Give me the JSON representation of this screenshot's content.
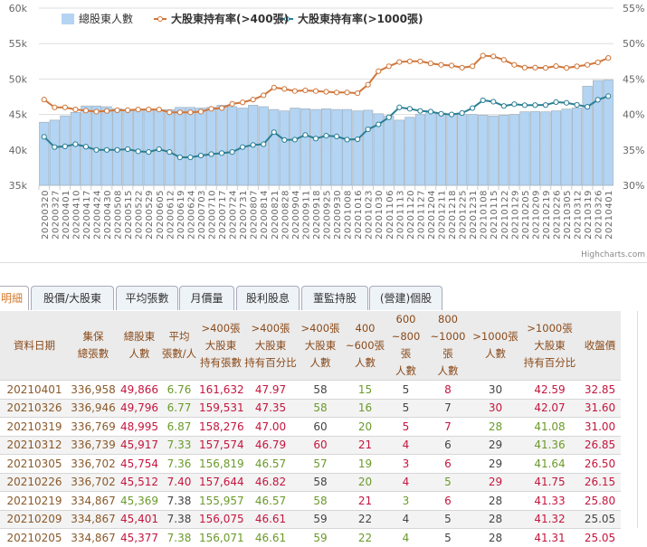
{
  "chart_data": {
    "type": "bar+line",
    "legend": [
      "總股東人數",
      "大股東持有率(>400張)",
      "大股東持有率(>1000張)"
    ],
    "legend_position": "top-left",
    "y_left": {
      "ticks": [
        "35k",
        "40k",
        "45k",
        "50k",
        "55k",
        "60k"
      ],
      "range": [
        35,
        60
      ]
    },
    "y_right": {
      "ticks": [
        "30%",
        "35%",
        "40%",
        "45%",
        "50%",
        "55%"
      ],
      "range": [
        30,
        55
      ]
    },
    "categories": [
      "20200320",
      "20200327",
      "20200401",
      "20200410",
      "20200417",
      "20200424",
      "20200430",
      "20200508",
      "20200515",
      "20200522",
      "20200529",
      "20200605",
      "20200612",
      "20200619",
      "20200624",
      "20200703",
      "20200710",
      "20200717",
      "20200724",
      "20200731",
      "20200807",
      "20200814",
      "20200821",
      "20200828",
      "20200904",
      "20200911",
      "20200918",
      "20200925",
      "20200930",
      "20201008",
      "20201016",
      "20201023",
      "20201030",
      "20201106",
      "20201113",
      "20201120",
      "20201127",
      "20201204",
      "20201211",
      "20201218",
      "20201225",
      "20201231",
      "20210108",
      "20210115",
      "20210122",
      "20210129",
      "20210205",
      "20210209",
      "20210219",
      "20210226",
      "20210305",
      "20210312",
      "20210319",
      "20210326",
      "20210401"
    ],
    "series": [
      {
        "name": "總股東人數",
        "type": "bar",
        "color": "#b3d4f2",
        "values": [
          43.9,
          44.2,
          44.8,
          45.3,
          46.2,
          46.2,
          46.1,
          45.8,
          45.7,
          45.7,
          45.7,
          45.7,
          45.7,
          46.0,
          46.0,
          45.9,
          46.0,
          46.3,
          46.1,
          45.9,
          46.3,
          46.1,
          45.7,
          45.5,
          45.9,
          45.8,
          45.7,
          45.8,
          45.7,
          45.7,
          45.5,
          45.6,
          45.1,
          44.8,
          44.2,
          44.6,
          45.0,
          45.3,
          45.2,
          45.0,
          45.0,
          45.0,
          44.9,
          44.8,
          44.9,
          45.0,
          45.377,
          45.401,
          45.369,
          45.512,
          45.754,
          45.917,
          48.995,
          49.796,
          49.866
        ]
      },
      {
        "name": "大股東持有率(>400張)",
        "type": "line",
        "color": "#d0763a",
        "values": [
          42.1,
          41.0,
          41.0,
          40.7,
          40.55,
          40.4,
          40.5,
          40.6,
          40.6,
          40.7,
          40.7,
          40.7,
          40.3,
          40.3,
          40.3,
          40.4,
          40.8,
          40.9,
          41.5,
          41.7,
          42.1,
          42.7,
          43.8,
          43.6,
          43.3,
          43.4,
          43.3,
          43.2,
          43.1,
          43.1,
          43.0,
          44.2,
          46.1,
          46.8,
          47.4,
          47.5,
          47.5,
          47.2,
          47.0,
          46.9,
          46.6,
          46.8,
          48.3,
          48.2,
          47.7,
          47.0,
          46.61,
          46.61,
          46.57,
          46.82,
          46.57,
          46.79,
          47.0,
          47.35,
          47.97
        ]
      },
      {
        "name": "大股東持有率(>1000張)",
        "type": "line",
        "color": "#2a7f95",
        "values": [
          36.85,
          35.4,
          35.5,
          35.8,
          35.45,
          35.0,
          35.0,
          35.0,
          35.1,
          34.8,
          34.7,
          35.1,
          34.7,
          33.95,
          33.95,
          34.2,
          34.4,
          34.55,
          34.7,
          35.4,
          35.7,
          35.8,
          37.5,
          36.4,
          36.45,
          37.1,
          36.6,
          37.0,
          36.9,
          36.45,
          36.5,
          37.9,
          38.6,
          39.6,
          41.0,
          40.8,
          40.5,
          40.4,
          40.1,
          40.0,
          40.2,
          40.9,
          42.0,
          41.8,
          41.2,
          41.45,
          41.31,
          41.32,
          41.33,
          41.75,
          41.64,
          41.36,
          41.08,
          42.07,
          42.59
        ]
      }
    ],
    "credits": "Highcharts.com"
  },
  "tabs": [
    "明細",
    "股價/大股東",
    "平均張數",
    "月價量",
    "股利股息",
    "董監持股",
    "(營建)個股"
  ],
  "table": {
    "headers": [
      [
        "資料日期"
      ],
      [
        "集保",
        "總張數"
      ],
      [
        "總股東",
        "人數"
      ],
      [
        "平均",
        "張數/人"
      ],
      [
        ">400張",
        "大股東",
        "持有張數"
      ],
      [
        ">400張",
        "大股東",
        "持有百分比"
      ],
      [
        ">400張",
        "大股東",
        "人數"
      ],
      [
        "400",
        "~600張",
        "人數"
      ],
      [
        "600",
        "~800張",
        "人數"
      ],
      [
        "800",
        "~1000張",
        "人數"
      ],
      [
        ">1000張",
        "人數"
      ],
      [
        ">1000張",
        "大股東",
        "持有百分比"
      ],
      [
        "收盤價"
      ]
    ],
    "rows": [
      {
        "cells": [
          "20210401",
          "336,958",
          "49,866",
          "6.76",
          "161,632",
          "47.97",
          "58",
          "15",
          "5",
          "8",
          "30",
          "42.59",
          "32.85"
        ],
        "colors": "bbrgrrngnrnrr"
      },
      {
        "cells": [
          "20210326",
          "336,946",
          "49,796",
          "6.77",
          "159,531",
          "47.35",
          "58",
          "16",
          "5",
          "7",
          "30",
          "42.07",
          "31.60"
        ],
        "colors": "bbrgrrggnnrrr"
      },
      {
        "cells": [
          "20210319",
          "336,769",
          "48,995",
          "6.87",
          "158,276",
          "47.00",
          "60",
          "20",
          "5",
          "7",
          "28",
          "41.08",
          "31.00"
        ],
        "colors": "bbrgrrngrrggr"
      },
      {
        "cells": [
          "20210312",
          "336,739",
          "45,917",
          "7.33",
          "157,574",
          "46.79",
          "60",
          "21",
          "4",
          "6",
          "29",
          "41.36",
          "26.85"
        ],
        "colors": "bbrgrrrrrnngr"
      },
      {
        "cells": [
          "20210305",
          "336,702",
          "45,754",
          "7.36",
          "156,819",
          "46.57",
          "57",
          "19",
          "3",
          "6",
          "29",
          "41.64",
          "26.50"
        ],
        "colors": "bbrgggggrrngr"
      },
      {
        "cells": [
          "20210226",
          "336,702",
          "45,512",
          "7.40",
          "157,644",
          "46.82",
          "58",
          "20",
          "4",
          "5",
          "29",
          "41.75",
          "26.15"
        ],
        "colors": "bbrrrrngrgrrr"
      },
      {
        "cells": [
          "20210219",
          "334,867",
          "45,369",
          "7.38",
          "155,957",
          "46.57",
          "58",
          "21",
          "3",
          "6",
          "28",
          "41.33",
          "25.80"
        ],
        "colors": "bbgngggrgrnrr"
      },
      {
        "cells": [
          "20210209",
          "334,867",
          "45,401",
          "7.38",
          "156,075",
          "46.61",
          "59",
          "22",
          "4",
          "5",
          "28",
          "41.32",
          "25.05"
        ],
        "colors": "bbrnrrnnnnnrn"
      },
      {
        "cells": [
          "20210205",
          "334,867",
          "45,377",
          "7.38",
          "156,071",
          "46.61",
          "59",
          "22",
          "4",
          "5",
          "28",
          "41.31",
          "25.05"
        ],
        "colors": "bbrggggggnnrr"
      }
    ]
  }
}
